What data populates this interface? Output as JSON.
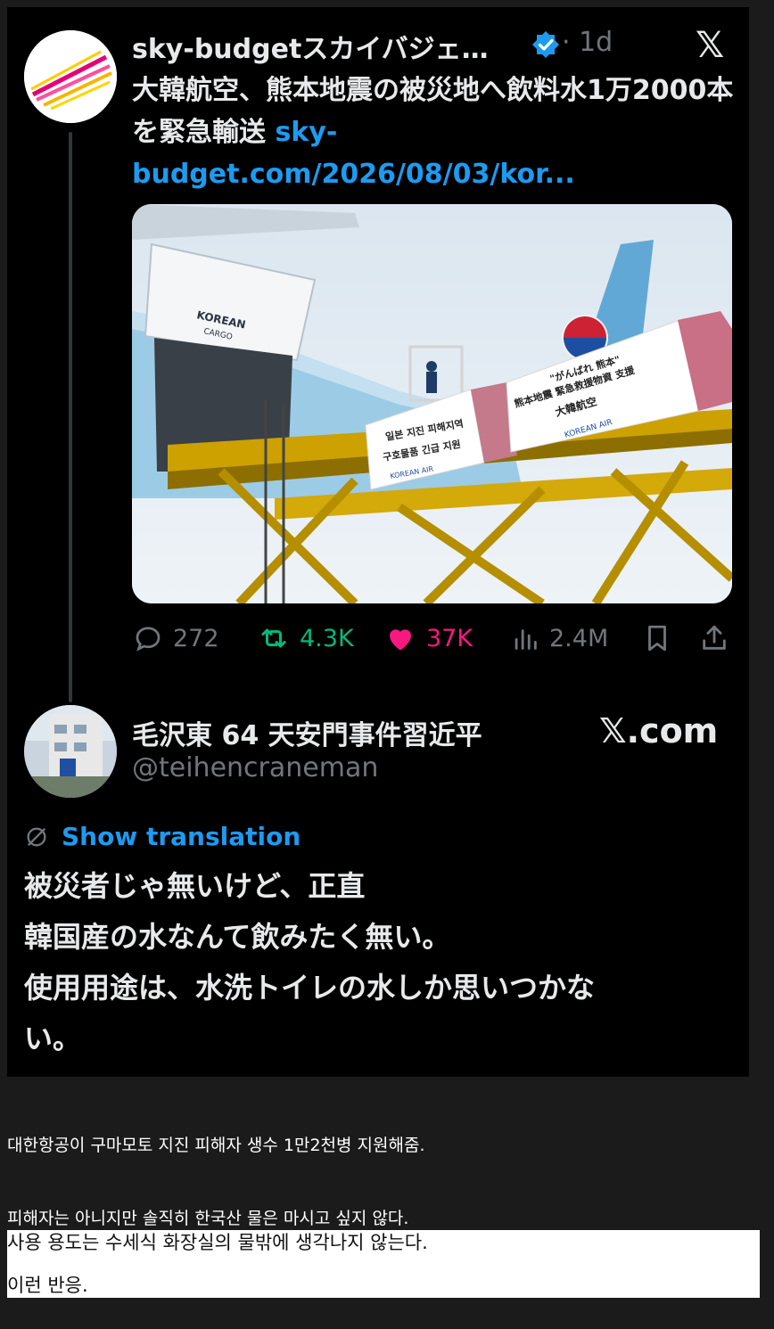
{
  "tweet": {
    "author_name": "sky-budgetスカイバジェ…",
    "time": "· 1d",
    "x_logo": "𝕏",
    "text": "大韓航空、熊本地震の被災地へ飲料水1万2000本を緊急輸送",
    "link": "sky-budget.com/2026/08/03/kor...",
    "image": {
      "fuselage_label_1": "KOREAN",
      "fuselage_label_2": "CARGO",
      "banner_left_line1": "일본 지진 피해지역",
      "banner_left_line2": "구호물품 긴급 지원",
      "banner_left_brand": "KOREAN AIR",
      "banner_right_line1": "\"がんばれ 熊本\"",
      "banner_right_line2": "熊本地震 緊急救援物資 支援",
      "banner_right_line3": "大韓航空",
      "banner_right_brand": "KOREAN AIR"
    },
    "stats": {
      "replies": "272",
      "retweets": "4.3K",
      "likes": "37K",
      "views": "2.4M"
    },
    "colors": {
      "retweet": "#00ba7c",
      "like": "#f91880",
      "link": "#1d9bf0"
    }
  },
  "reply": {
    "author_name": "毛沢東 64 天安門事件習近平",
    "handle": "@teihencraneman",
    "site": "𝕏.com",
    "translate_label": "Show translation",
    "lines": [
      "被災者じゃ無いけど、正直",
      "韓国産の水なんて飲みたく無い。",
      "使用用途は、水洗トイレの水しか思いつかな",
      "い。"
    ]
  },
  "captions": {
    "line1": "대한항공이 구마모토 지진 피해자 생수 1만2천병 지원해줌.",
    "line2": "피해자는 아니지만 솔직히 한국산 물은 마시고 싶지 않다.",
    "line3": "사용 용도는 수세식 화장실의 물밖에 생각나지 않는다.",
    "line4": "이런 반응."
  }
}
